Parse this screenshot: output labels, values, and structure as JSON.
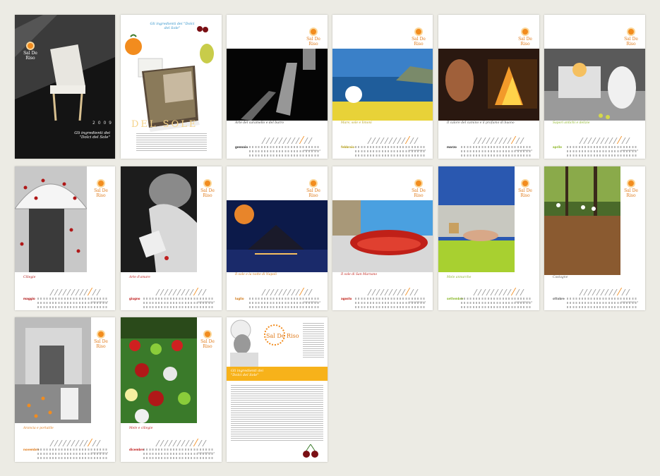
{
  "year": "2 0 0 9",
  "cover_title": "Gli ingredienti dei \"Dolci del Sole\"",
  "book_title_small": "Gli ingredienti dei \"Dolci del Sole\"",
  "book_big": "DEL SOLE",
  "brand": "Sal De Riso",
  "brand_sub": "costiera amalfitana",
  "website": "www.salderiso.it",
  "months": [
    {
      "name": "gennaio",
      "caption": "Arte del caramello e del burro"
    },
    {
      "name": "febbraio",
      "caption": "Mare, sole e limoni"
    },
    {
      "name": "marzo",
      "caption": "Il calore del camino e il profumo di buono"
    },
    {
      "name": "aprile",
      "caption": "Sapori antichi e delizie"
    },
    {
      "name": "maggio",
      "caption": "Ciliegie"
    },
    {
      "name": "giugno",
      "caption": "Arte d'amare"
    },
    {
      "name": "luglio",
      "caption": "Il sole e la notte di Napoli"
    },
    {
      "name": "agosto",
      "caption": "Il sole di San Marzano"
    },
    {
      "name": "settembre",
      "caption": "Mele annurche"
    },
    {
      "name": "ottobre",
      "caption": "Castagne"
    },
    {
      "name": "novembre",
      "caption": "Arancia e portatile"
    },
    {
      "name": "dicembre",
      "caption": "Mele e ciliegie"
    }
  ],
  "back_title": "Gli ingredienti dei \"Dolci del Sole\"",
  "colors": {
    "accent": "#f28c1e",
    "bg": "#ecebe4"
  }
}
